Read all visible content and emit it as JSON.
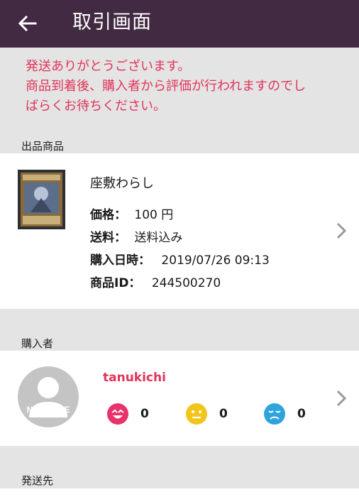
{
  "header": {
    "title": "取引画面"
  },
  "notice": {
    "lines": [
      "発送ありがとうございます。",
      "商品到着後、購入者から評価が行われますのでし",
      "ばらくお待ちください。"
    ]
  },
  "product_section": {
    "label": "出品商品",
    "name": "座敷わらし",
    "price_label": "価格：",
    "price_value": "100 円",
    "shipping_label": "送料：",
    "shipping_value": "送料込み",
    "date_label": "購入日時：",
    "date_value": "2019/07/26 09:13",
    "id_label": "商品ID：",
    "id_value": "244500270"
  },
  "buyer_section": {
    "label": "購入者",
    "avatar_text": "NO IMAGE",
    "name": "tanukichi",
    "ratings": [
      {
        "icon": "happy-face-icon",
        "color": "#e8336a",
        "count": "0"
      },
      {
        "icon": "neutral-face-icon",
        "color": "#f2c51c",
        "count": "0"
      },
      {
        "icon": "sad-face-icon",
        "color": "#2ea3dc",
        "count": "0"
      }
    ]
  },
  "shipping_section": {
    "label": "発送先"
  },
  "colors": {
    "appbar": "#422a42",
    "accent": "#e0345a"
  }
}
